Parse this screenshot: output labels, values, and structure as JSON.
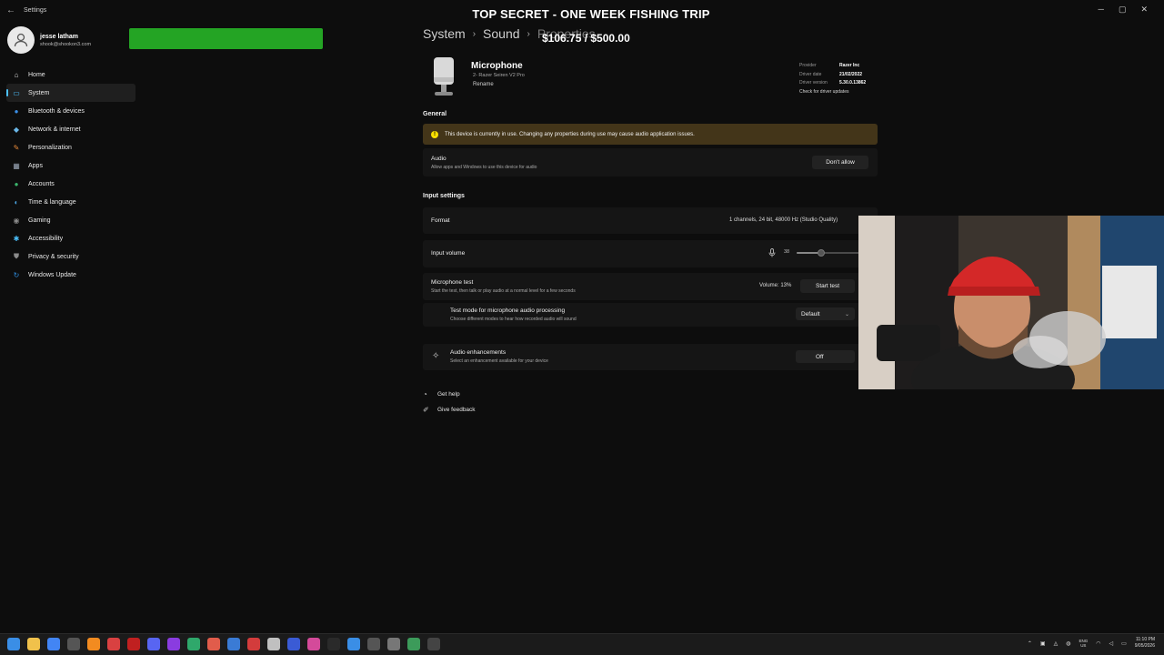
{
  "window": {
    "title": "Settings",
    "controls": [
      "─",
      "▢",
      "✕"
    ]
  },
  "profile": {
    "name": "jesse latham",
    "email": "shook@shookon3.com"
  },
  "overlay": {
    "title": "TOP SECRET - ONE WEEK FISHING TRIP",
    "progress_text": "$106.75 / $500.00",
    "progress_fraction": 0.2135,
    "bar_color": "#24a424"
  },
  "breadcrumb": {
    "items": [
      "System",
      "Sound",
      "Properties"
    ]
  },
  "sidebar": {
    "items": [
      {
        "label": "Home",
        "icon": "home-icon",
        "glyph": "⌂",
        "color": "#dddddd"
      },
      {
        "label": "System",
        "icon": "system-icon",
        "glyph": "▭",
        "color": "#4cc2ff",
        "active": true
      },
      {
        "label": "Bluetooth & devices",
        "icon": "bluetooth-icon",
        "glyph": "●",
        "color": "#3a8ee6"
      },
      {
        "label": "Network & internet",
        "icon": "wifi-icon",
        "glyph": "◆",
        "color": "#6ab7e8"
      },
      {
        "label": "Personalization",
        "icon": "brush-icon",
        "glyph": "✎",
        "color": "#e88b3a"
      },
      {
        "label": "Apps",
        "icon": "apps-icon",
        "glyph": "▦",
        "color": "#9aa5b5"
      },
      {
        "label": "Accounts",
        "icon": "person-icon",
        "glyph": "●",
        "color": "#3bb56c"
      },
      {
        "label": "Time & language",
        "icon": "globe-icon",
        "glyph": "◐",
        "color": "#4aa3df"
      },
      {
        "label": "Gaming",
        "icon": "gamepad-icon",
        "glyph": "◉",
        "color": "#8b8b8b"
      },
      {
        "label": "Accessibility",
        "icon": "accessibility-icon",
        "glyph": "✱",
        "color": "#4cc2ff"
      },
      {
        "label": "Privacy & security",
        "icon": "shield-icon",
        "glyph": "⛊",
        "color": "#8b8b8b"
      },
      {
        "label": "Windows Update",
        "icon": "update-icon",
        "glyph": "↻",
        "color": "#2f8ee0"
      }
    ]
  },
  "device": {
    "name": "Microphone",
    "model": "2- Razer Seiren V2 Pro",
    "rename": "Rename"
  },
  "driver": {
    "provider_label": "Provider",
    "provider_value": "Razer Inc",
    "date_label": "Driver date",
    "date_value": "21/02/2022",
    "version_label": "Driver version",
    "version_value": "5.30.0.13862",
    "updates_link": "Check for driver updates"
  },
  "general": {
    "heading": "General",
    "warning": "This device is currently in use. Changing any properties during use may cause audio application issues.",
    "audio_title": "Audio",
    "audio_desc": "Allow apps and Windows to use this device for audio",
    "audio_button": "Don't allow"
  },
  "input_settings": {
    "heading": "Input settings",
    "format_label": "Format",
    "format_value": "1 channels, 24 bit, 48000 Hz (Studio Quality)",
    "volume_label": "Input volume",
    "volume_value": "38",
    "volume_level": 0.38,
    "mic_test_title": "Microphone test",
    "mic_test_desc": "Start the test, then talk or play audio at a normal level for a few seconds",
    "mic_test_volume": "Volume: 13%",
    "start_test": "Start test",
    "test_mode_title": "Test mode for microphone audio processing",
    "test_mode_desc": "Choose different modes to hear how recorded audio will sound",
    "test_mode_value": "Default"
  },
  "enhancements": {
    "title": "Audio enhancements",
    "desc": "Select an enhancement available for your device",
    "value": "Off"
  },
  "help_links": {
    "get_help": "Get help",
    "feedback": "Give feedback"
  },
  "taskbar": {
    "apps": [
      {
        "icon": "windows-start-icon",
        "color": "#3a8ee6"
      },
      {
        "icon": "file-explorer-icon",
        "color": "#f0c14b"
      },
      {
        "icon": "chrome-icon",
        "color": "#4285f4"
      },
      {
        "icon": "obs-icon",
        "color": "#555555"
      },
      {
        "icon": "vlc-icon",
        "color": "#f28b20"
      },
      {
        "icon": "app-icon",
        "color": "#d94141"
      },
      {
        "icon": "app-icon",
        "color": "#c02020"
      },
      {
        "icon": "discord-icon",
        "color": "#5865f2"
      },
      {
        "icon": "app-icon",
        "color": "#8a3ce0"
      },
      {
        "icon": "edge-icon",
        "color": "#2fa86b"
      },
      {
        "icon": "pen-icon",
        "color": "#e15c4b"
      },
      {
        "icon": "app-icon",
        "color": "#3a7bd5"
      },
      {
        "icon": "app-icon",
        "color": "#d33c3c"
      },
      {
        "icon": "app-icon",
        "color": "#c0c0c0"
      },
      {
        "icon": "app-icon",
        "color": "#3a5bd5"
      },
      {
        "icon": "app-icon",
        "color": "#d44a9a"
      },
      {
        "icon": "app-icon",
        "color": "#2a2a2a"
      },
      {
        "icon": "app-icon",
        "color": "#3a8ee6"
      },
      {
        "icon": "app-icon",
        "color": "#555555"
      },
      {
        "icon": "settings-icon",
        "color": "#777777"
      },
      {
        "icon": "app-icon",
        "color": "#3c9b5a"
      },
      {
        "icon": "app-icon",
        "color": "#444444"
      }
    ],
    "lang": "ENG",
    "region": "US",
    "time": "11:10 PM",
    "date": "9/05/2026"
  }
}
